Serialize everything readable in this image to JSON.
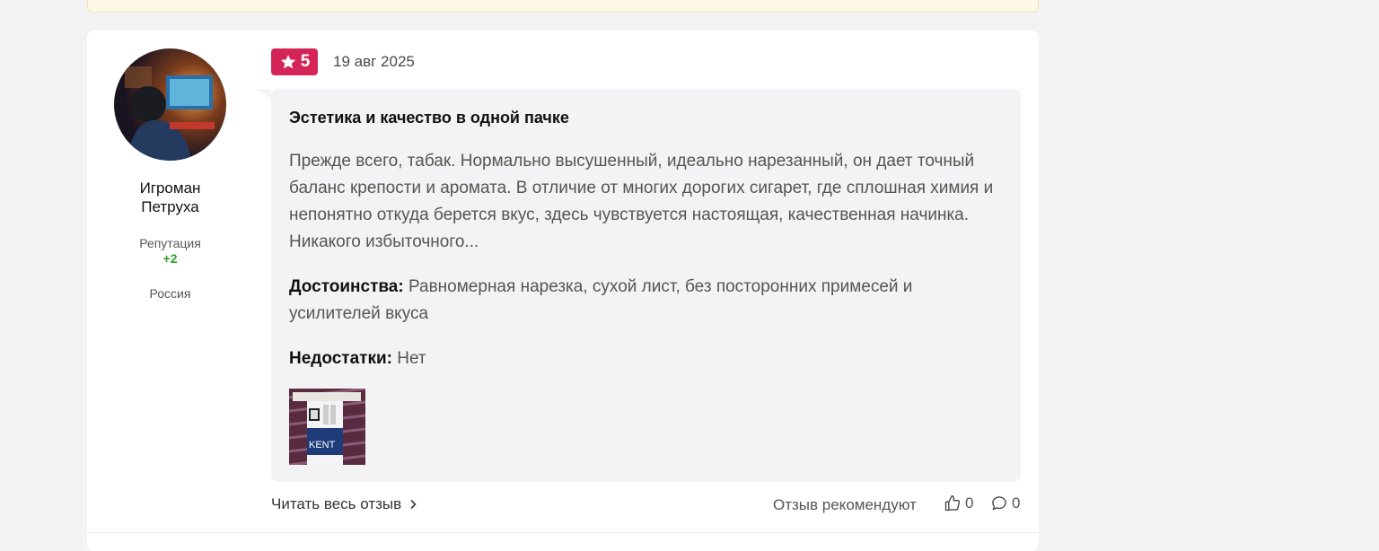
{
  "review": {
    "author": {
      "name": "Игроман Петруха",
      "reputation_label": "Репутация",
      "reputation_value": "+2",
      "country": "Россия"
    },
    "rating": "5",
    "date": "19 авг 2025",
    "title": "Эстетика и качество в одной пачке",
    "body": "Прежде всего, табак. Нормально высушенный, идеально нарезанный, он дает точный баланс крепости и аромата. В отличие от многих дорогих сигарет, где сплошная химия и непонятно откуда берется вкус, здесь чувствуется настоящая, качественная начинка. Никакого избыточного...",
    "pros_label": "Достоинства:",
    "pros_text": "Равномерная нарезка, сухой лист, без посторонних примесей и усилителей вкуса",
    "cons_label": "Недостатки:",
    "cons_text": "Нет",
    "photo_text": "KENT",
    "footer": {
      "read_more": "Читать весь отзыв",
      "recommend_label": "Отзыв рекомендуют",
      "likes": "0",
      "comments": "0"
    }
  },
  "colors": {
    "rating_badge": "#d52457",
    "reputation_positive": "#2aa42a",
    "notice_bar": "#fef8e7"
  },
  "icons": [
    "star-icon",
    "chevron-right-icon",
    "thumbs-up-icon",
    "comment-icon"
  ]
}
